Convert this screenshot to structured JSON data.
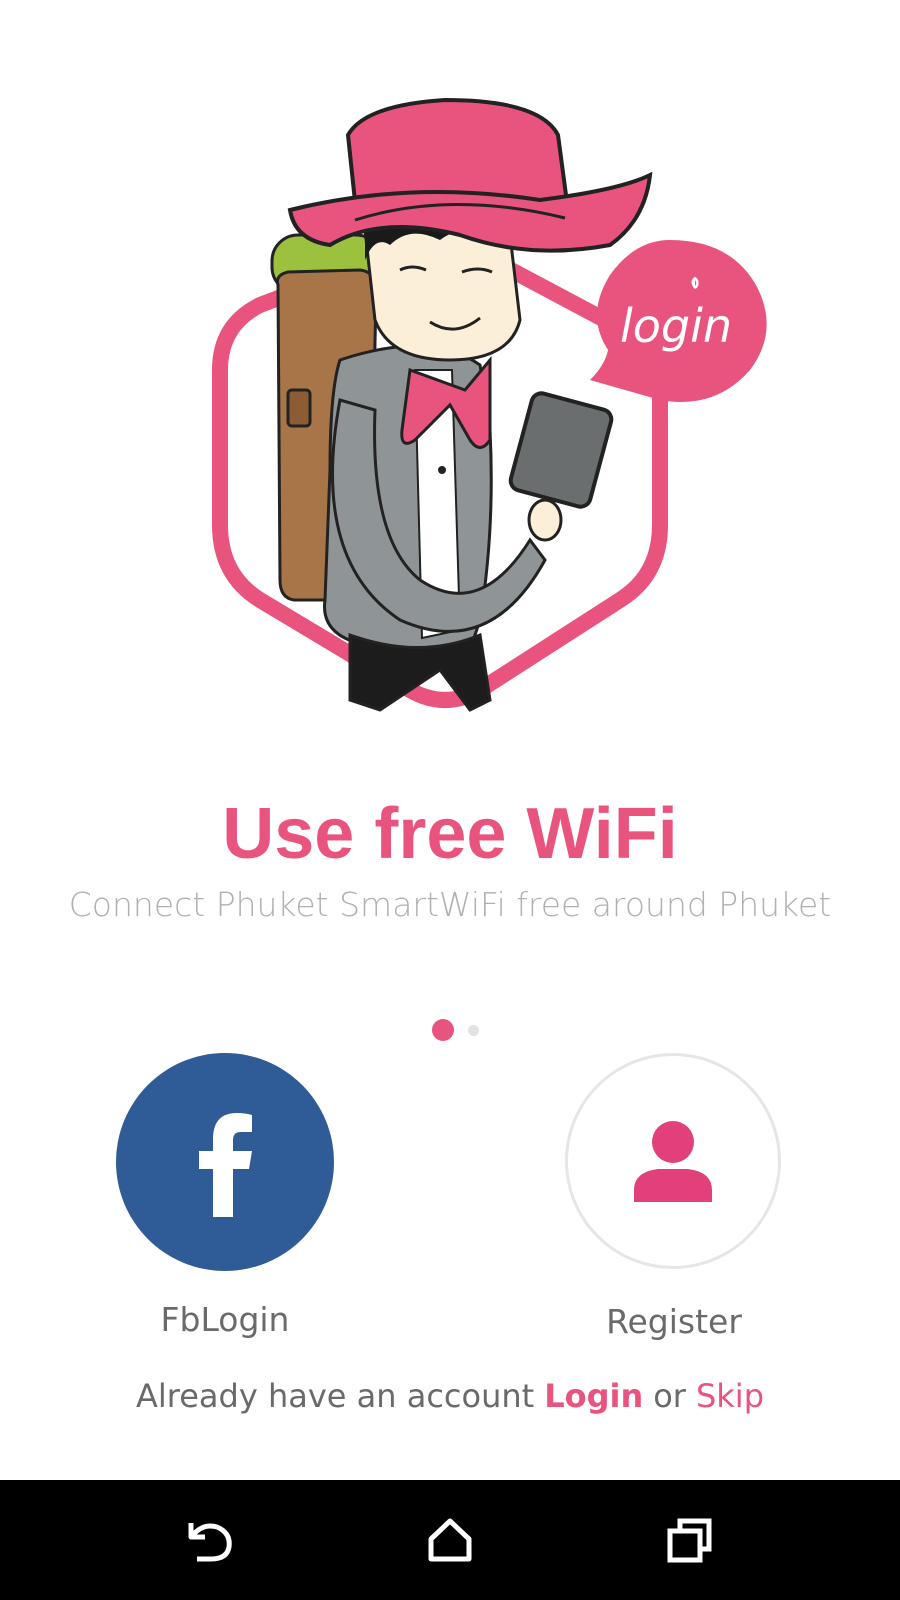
{
  "hero": {
    "bubble_text": "login",
    "headline": "Use free WiFi",
    "subtitle": "Connect Phuket SmartWiFi free around Phuket"
  },
  "pager": {
    "count": 2,
    "active_index": 0
  },
  "actions": {
    "facebook": {
      "label": "FbLogin",
      "icon": "facebook-icon",
      "color": "#2f5b96"
    },
    "register": {
      "label": "Register",
      "icon": "person-icon",
      "color": "#e1407a"
    }
  },
  "account": {
    "prompt": "Already have an account",
    "login_label": "Login",
    "or_text": "or",
    "skip_label": "Skip"
  },
  "navbar": {
    "back_icon": "back-icon",
    "home_icon": "home-icon",
    "recent_icon": "recent-apps-icon"
  },
  "colors": {
    "accent": "#e9547f",
    "facebook_blue": "#2f5b96",
    "subtitle_gray": "#b0b0b0",
    "text_gray": "#6a6a6a"
  }
}
